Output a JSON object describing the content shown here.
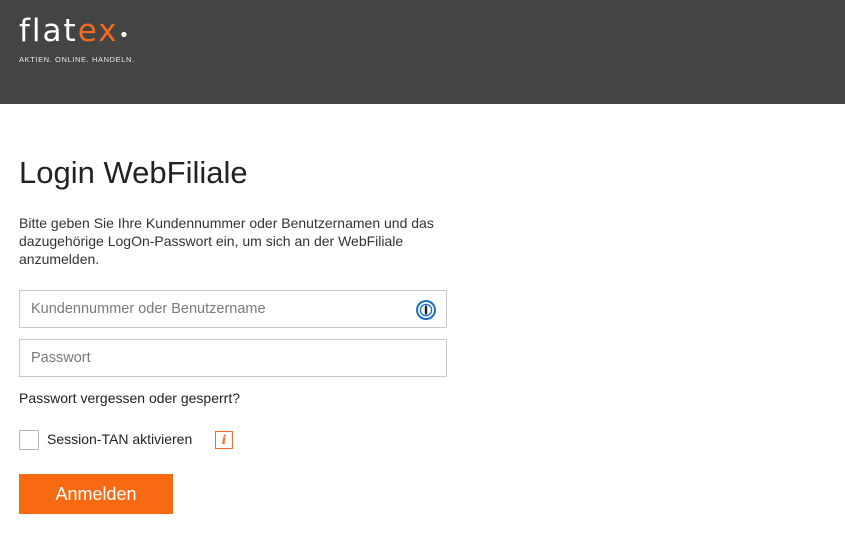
{
  "header": {
    "logo_wordmark_white": "flat",
    "logo_wordmark_orange": "ex",
    "logo_tagline": "AKTIEN. ONLINE. HANDELN.",
    "background_color": "#444444",
    "brand_color": "#f26b21"
  },
  "main": {
    "title": "Login WebFiliale",
    "intro": "Bitte geben Sie Ihre Kundennummer oder Benutzernamen und das dazugehörige LogOn-Passwort ein, um sich an der WebFiliale anzumelden.",
    "username_field": {
      "placeholder": "Kundennummer oder Benutzername",
      "value": "",
      "icon": "password-manager-icon"
    },
    "password_field": {
      "placeholder": "Passwort",
      "value": ""
    },
    "forgot_link": "Passwort vergessen oder gesperrt?",
    "session_tan": {
      "label": "Session-TAN aktivieren",
      "checked": false,
      "info_icon": "i"
    },
    "login_button": "Anmelden",
    "button_color": "#f86a12"
  }
}
